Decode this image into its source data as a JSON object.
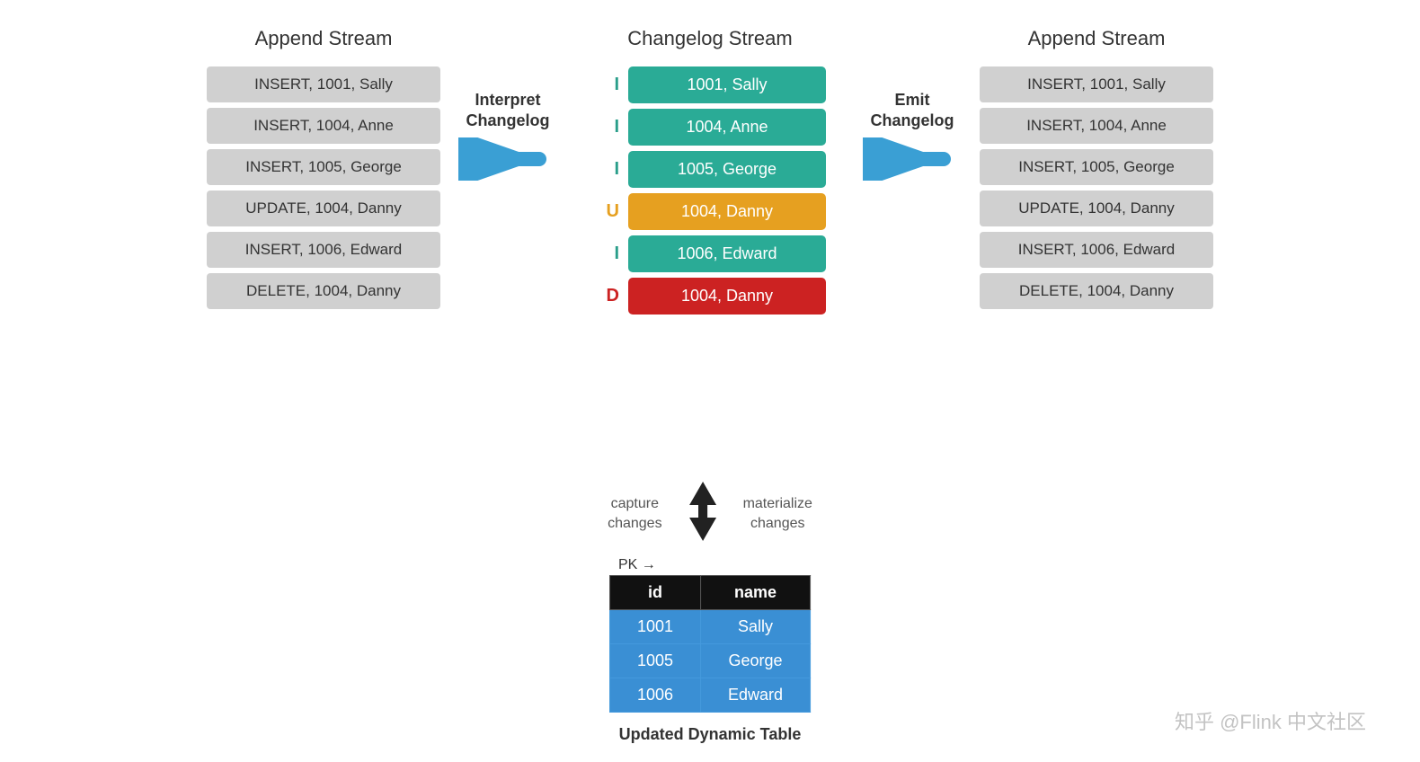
{
  "leftStream": {
    "title": "Append Stream",
    "rows": [
      "INSERT, 1001, Sally",
      "INSERT, 1004, Anne",
      "INSERT, 1005, George",
      "UPDATE, 1004, Danny",
      "INSERT, 1006, Edward",
      "DELETE, 1004, Danny"
    ]
  },
  "middleStream": {
    "title": "Changelog Stream",
    "rows": [
      {
        "type": "insert",
        "letter": "I",
        "text": "1001, Sally"
      },
      {
        "type": "insert",
        "letter": "I",
        "text": "1004, Anne"
      },
      {
        "type": "insert",
        "letter": "I",
        "text": "1005, George"
      },
      {
        "type": "update",
        "letter": "U",
        "text": "1004, Danny"
      },
      {
        "type": "insert",
        "letter": "I",
        "text": "1006, Edward"
      },
      {
        "type": "delete",
        "letter": "D",
        "text": "1004, Danny"
      }
    ]
  },
  "rightStream": {
    "title": "Append Stream",
    "rows": [
      "INSERT, 1001, Sally",
      "INSERT, 1004, Anne",
      "INSERT, 1005, George",
      "UPDATE, 1004, Danny",
      "INSERT, 1006, Edward",
      "DELETE, 1004, Danny"
    ]
  },
  "arrows": {
    "interpretLabel": "Interpret\nChangelog",
    "emitLabel": "Emit\nChangelog"
  },
  "bottomSection": {
    "captureLabel": "capture\nchanges",
    "materializeLabel": "materialize\nchanges",
    "pkLabel": "PK →",
    "tableHeaders": [
      "id",
      "name"
    ],
    "tableRows": [
      [
        "1001",
        "Sally"
      ],
      [
        "1005",
        "George"
      ],
      [
        "1006",
        "Edward"
      ]
    ],
    "tableCaption": "Updated Dynamic Table"
  },
  "watermark": "知乎 @Flink 中文社区"
}
